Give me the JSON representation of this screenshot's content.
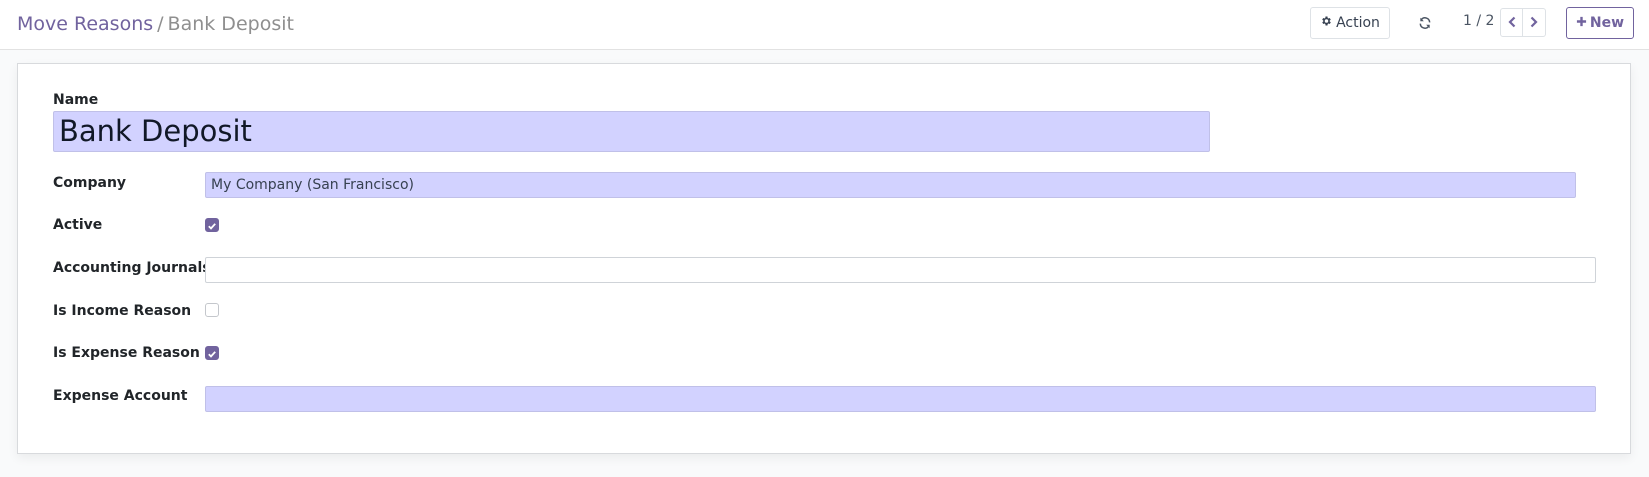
{
  "breadcrumb": {
    "parent": "Move Reasons",
    "separator": "/",
    "current": "Bank Deposit"
  },
  "toolbar": {
    "action_label": "Action",
    "action_icon": "gear-icon",
    "reload_icon": "refresh-icon",
    "pager_value": "1 / 2",
    "new_label": "New"
  },
  "form": {
    "name_label": "Name",
    "name_value": "Bank Deposit",
    "company_label": "Company",
    "company_value": "My Company (San Francisco)",
    "active_label": "Active",
    "active_checked": true,
    "journals_label": "Accounting Journals",
    "journals_value": "",
    "income_label": "Is Income Reason",
    "income_checked": false,
    "expense_reason_label": "Is Expense Reason",
    "expense_reason_checked": true,
    "expense_account_label": "Expense Account",
    "expense_account_value": ""
  },
  "colors": {
    "accent": "#71639e",
    "required_field": "#d2d2ff"
  }
}
